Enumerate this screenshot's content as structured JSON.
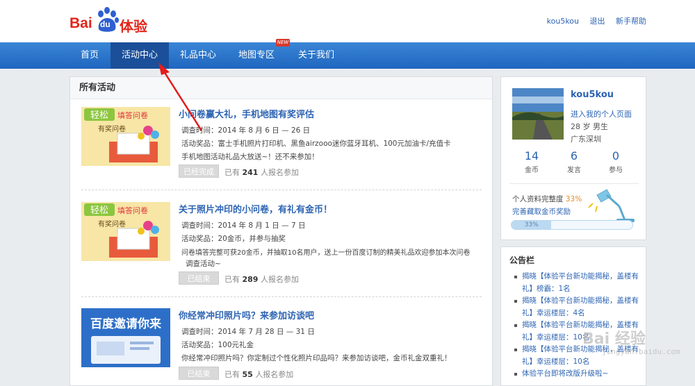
{
  "brand": {
    "bai": "Bai",
    "du": "du",
    "tiyan": "体验"
  },
  "header": {
    "username": "kou5kou",
    "logout": "退出",
    "help": "新手帮助"
  },
  "nav": {
    "items": [
      "首页",
      "活动中心",
      "礼品中心",
      "地图专区",
      "关于我们"
    ],
    "active": "活动中心",
    "new_badge": "NEW"
  },
  "main": {
    "title": "所有活动",
    "activities": [
      {
        "title": "小问卷赢大礼，手机地图有奖评估",
        "lines": [
          "调查时间：2014 年 8 月 6 日 — 26 日",
          "活动奖品：富士手机照片打印机、黑鱼airzooo迷你蓝牙耳机、100元加油卡/充值卡",
          "手机地图活动礼品大放送~！还不来参加！"
        ],
        "button": "已经完成",
        "joined_prefix": "已有",
        "joined_count": "241",
        "joined_suffix": "人报名参加",
        "banner_top": "轻松",
        "banner_mid": "填答问卷",
        "banner_bottom": "有奖问卷"
      },
      {
        "title": "关于照片冲印的小问卷，有礼有金币！",
        "lines": [
          "调查时间：2014 年 8 月 1 日 — 7 日",
          "活动奖品：20金币，并参与抽奖",
          "问卷填答完整可获20金币，并抽取10名用户，送上一份百度订制的精美礼品欢迎参加本次问卷",
          "调查活动~"
        ],
        "button": "已结束",
        "joined_prefix": "已有",
        "joined_count": "289",
        "joined_suffix": "人报名参加",
        "banner_top": "轻松",
        "banner_mid": "填答问卷",
        "banner_bottom": "有奖问卷"
      },
      {
        "title": "你经常冲印照片吗？来参加访谈吧",
        "lines": [
          "调查时间：2014 年 7 月 28 日 — 31 日",
          "活动奖品：100元礼金",
          "你经常冲印照片吗？你定制过个性化照片印品吗？来参加访谈吧，金币礼金双重礼！"
        ],
        "button": "已结束",
        "joined_prefix": "已有",
        "joined_count": "55",
        "joined_suffix": "人报名参加",
        "banner_text": "百度邀请你来"
      }
    ]
  },
  "profile": {
    "name": "kou5kou",
    "link": "进入我的个人页面",
    "age_gender": "28 岁 男生",
    "location": "广东深圳",
    "stats": [
      {
        "num": "14",
        "label": "金币"
      },
      {
        "num": "6",
        "label": "发言"
      },
      {
        "num": "0",
        "label": "参与"
      }
    ],
    "completeness_label": "个人资料完整度",
    "completeness_pct": "33%",
    "completeness_value": 33,
    "reward_link": "完善藏取金币奖励",
    "bar_text": "33%"
  },
  "notice": {
    "title": "公告栏",
    "items": [
      "揭晓【体验平台新功能揭秘，盖楼有礼】榜霸：1名",
      "揭晓【体验平台新功能揭秘，盖楼有礼】幸运楼层：4名",
      "揭晓【体验平台新功能揭秘，盖楼有礼】幸运楼层：10名",
      "揭晓【体验平台新功能揭秘，盖楼有礼】幸运楼层：10名",
      "体验平台即将改版升级啦~"
    ]
  },
  "watermark": {
    "main": "Bai 经验",
    "sub": "jingyan.baidu.com"
  },
  "colors": {
    "nav": "#2b74cc",
    "link": "#2d64b3",
    "brand_red": "#e1251b"
  }
}
